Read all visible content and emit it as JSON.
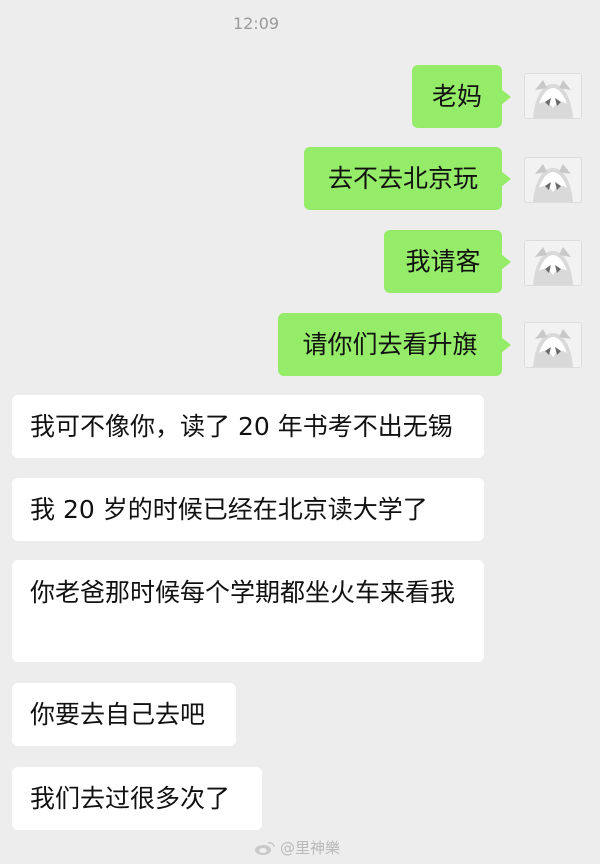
{
  "chat": {
    "time": "12:09",
    "messages": [
      {
        "sender": "me",
        "text": "老妈"
      },
      {
        "sender": "me",
        "text": "去不去北京玩"
      },
      {
        "sender": "me",
        "text": "我请客"
      },
      {
        "sender": "me",
        "text": "请你们去看升旗"
      },
      {
        "sender": "other",
        "text": "我可不像你，读了 20 年书考不出无锡"
      },
      {
        "sender": "other",
        "text": "我 20 岁的时候已经在北京读大学了"
      },
      {
        "sender": "other",
        "text": "你老爸那时候每个学期都坐火车来看我"
      },
      {
        "sender": "other",
        "text": "你要去自己去吧"
      },
      {
        "sender": "other",
        "text": "我们去过很多次了"
      }
    ]
  },
  "colors": {
    "background": "#ededed",
    "my_bubble": "#95ec69",
    "their_bubble": "#ffffff"
  },
  "watermark": {
    "icon": "weibo-icon",
    "text": "@里神樂"
  },
  "icons": {
    "avatar": "anime-character-avatar"
  }
}
